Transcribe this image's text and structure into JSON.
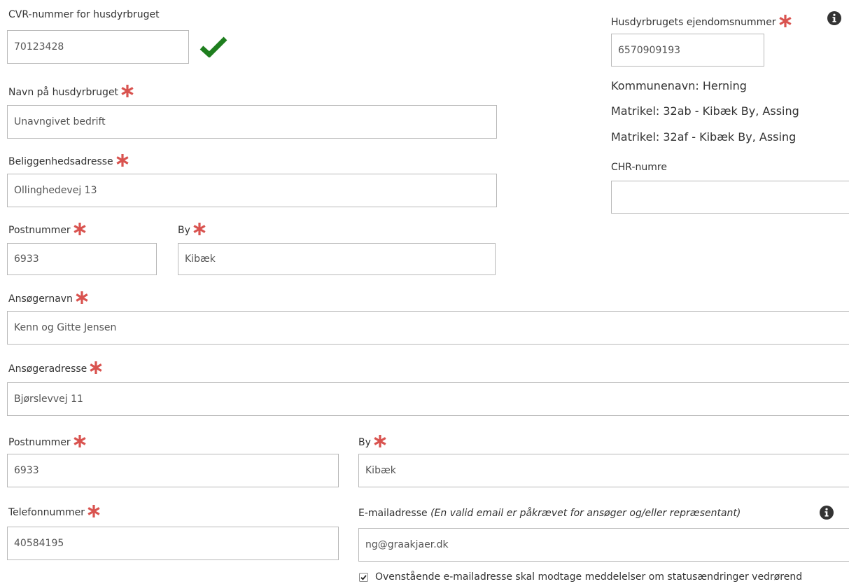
{
  "form": {
    "cvr": {
      "label": "CVR-nummer for husdyrbruget",
      "value": "70123428"
    },
    "name": {
      "label": "Navn på husdyrbruget",
      "value": "Unavngivet bedrift"
    },
    "address": {
      "label": "Beliggenhedsadresse",
      "value": "Ollinghedevej 13"
    },
    "postal1": {
      "label": "Postnummer",
      "value": "6933"
    },
    "city1": {
      "label": "By",
      "value": "Kibæk"
    },
    "applicant_name": {
      "label": "Ansøgernavn",
      "value": "Kenn og Gitte Jensen"
    },
    "applicant_address": {
      "label": "Ansøgeradresse",
      "value": "Bjørslevvej 11"
    },
    "postal2": {
      "label": "Postnummer",
      "value": "6933"
    },
    "city2": {
      "label": "By",
      "value": "Kibæk"
    },
    "phone": {
      "label": "Telefonnummer",
      "value": "40584195"
    },
    "email": {
      "label": "E-mailadresse",
      "note": "(En valid email er påkrævet for ansøger og/eller repræsentant)",
      "value": "ng@graakjaer.dk"
    },
    "notify_checkbox": {
      "label": "Ovenstående e-mailadresse skal modtage meddelelser om statusændringer vedrørend",
      "checked": true
    }
  },
  "property": {
    "label": "Husdyrbrugets ejendomsnummer",
    "value": "6570909193",
    "municipality": "Kommunenavn: Herning",
    "matrikel1": "Matrikel: 32ab - Kibæk By, Assing",
    "matrikel2": "Matrikel: 32af - Kibæk By, Assing",
    "chr_label": "CHR-numre",
    "chr_value": ""
  },
  "colors": {
    "required_star": "#d9534f",
    "valid_check": "#1e7e1e",
    "info_icon": "#333333"
  }
}
